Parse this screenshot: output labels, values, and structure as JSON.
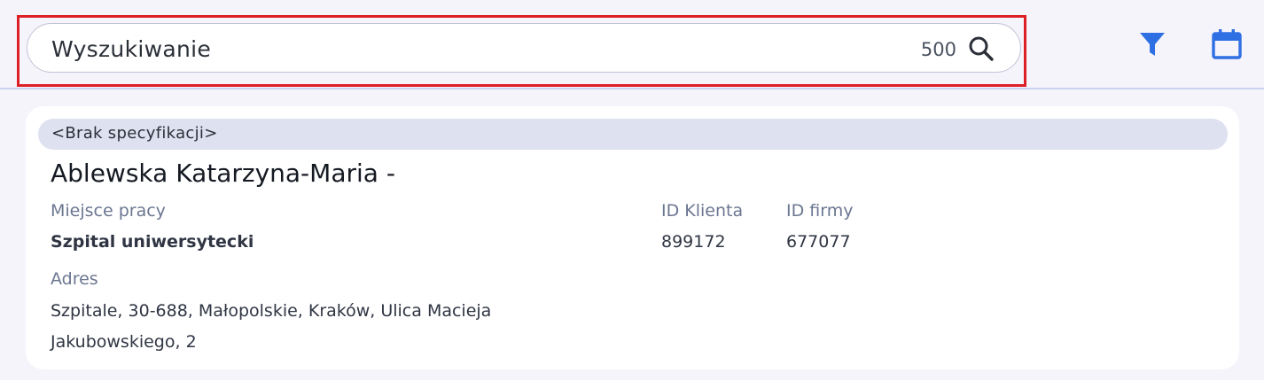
{
  "search": {
    "placeholder": "Wyszukiwanie",
    "result_count": "500"
  },
  "toolbar": {
    "filter_icon": "filter-icon",
    "calendar_icon": "calendar-icon"
  },
  "colors": {
    "accent": "#2f6fe4",
    "highlight": "#dd1f26"
  },
  "card": {
    "specification": "<Brak specyfikacji>",
    "name": "Ablewska Katarzyna-Maria -",
    "workplace_label": "Miejsce pracy",
    "workplace_value": "Szpital uniwersytecki",
    "client_id_label": "ID Klienta",
    "client_id_value": "899172",
    "firm_id_label": "ID firmy",
    "firm_id_value": "677077",
    "address_label": "Adres",
    "address_line1": "Szpitale, 30-688, Małopolskie, Kraków, Ulica Macieja",
    "address_line2": "Jakubowskiego, 2"
  }
}
